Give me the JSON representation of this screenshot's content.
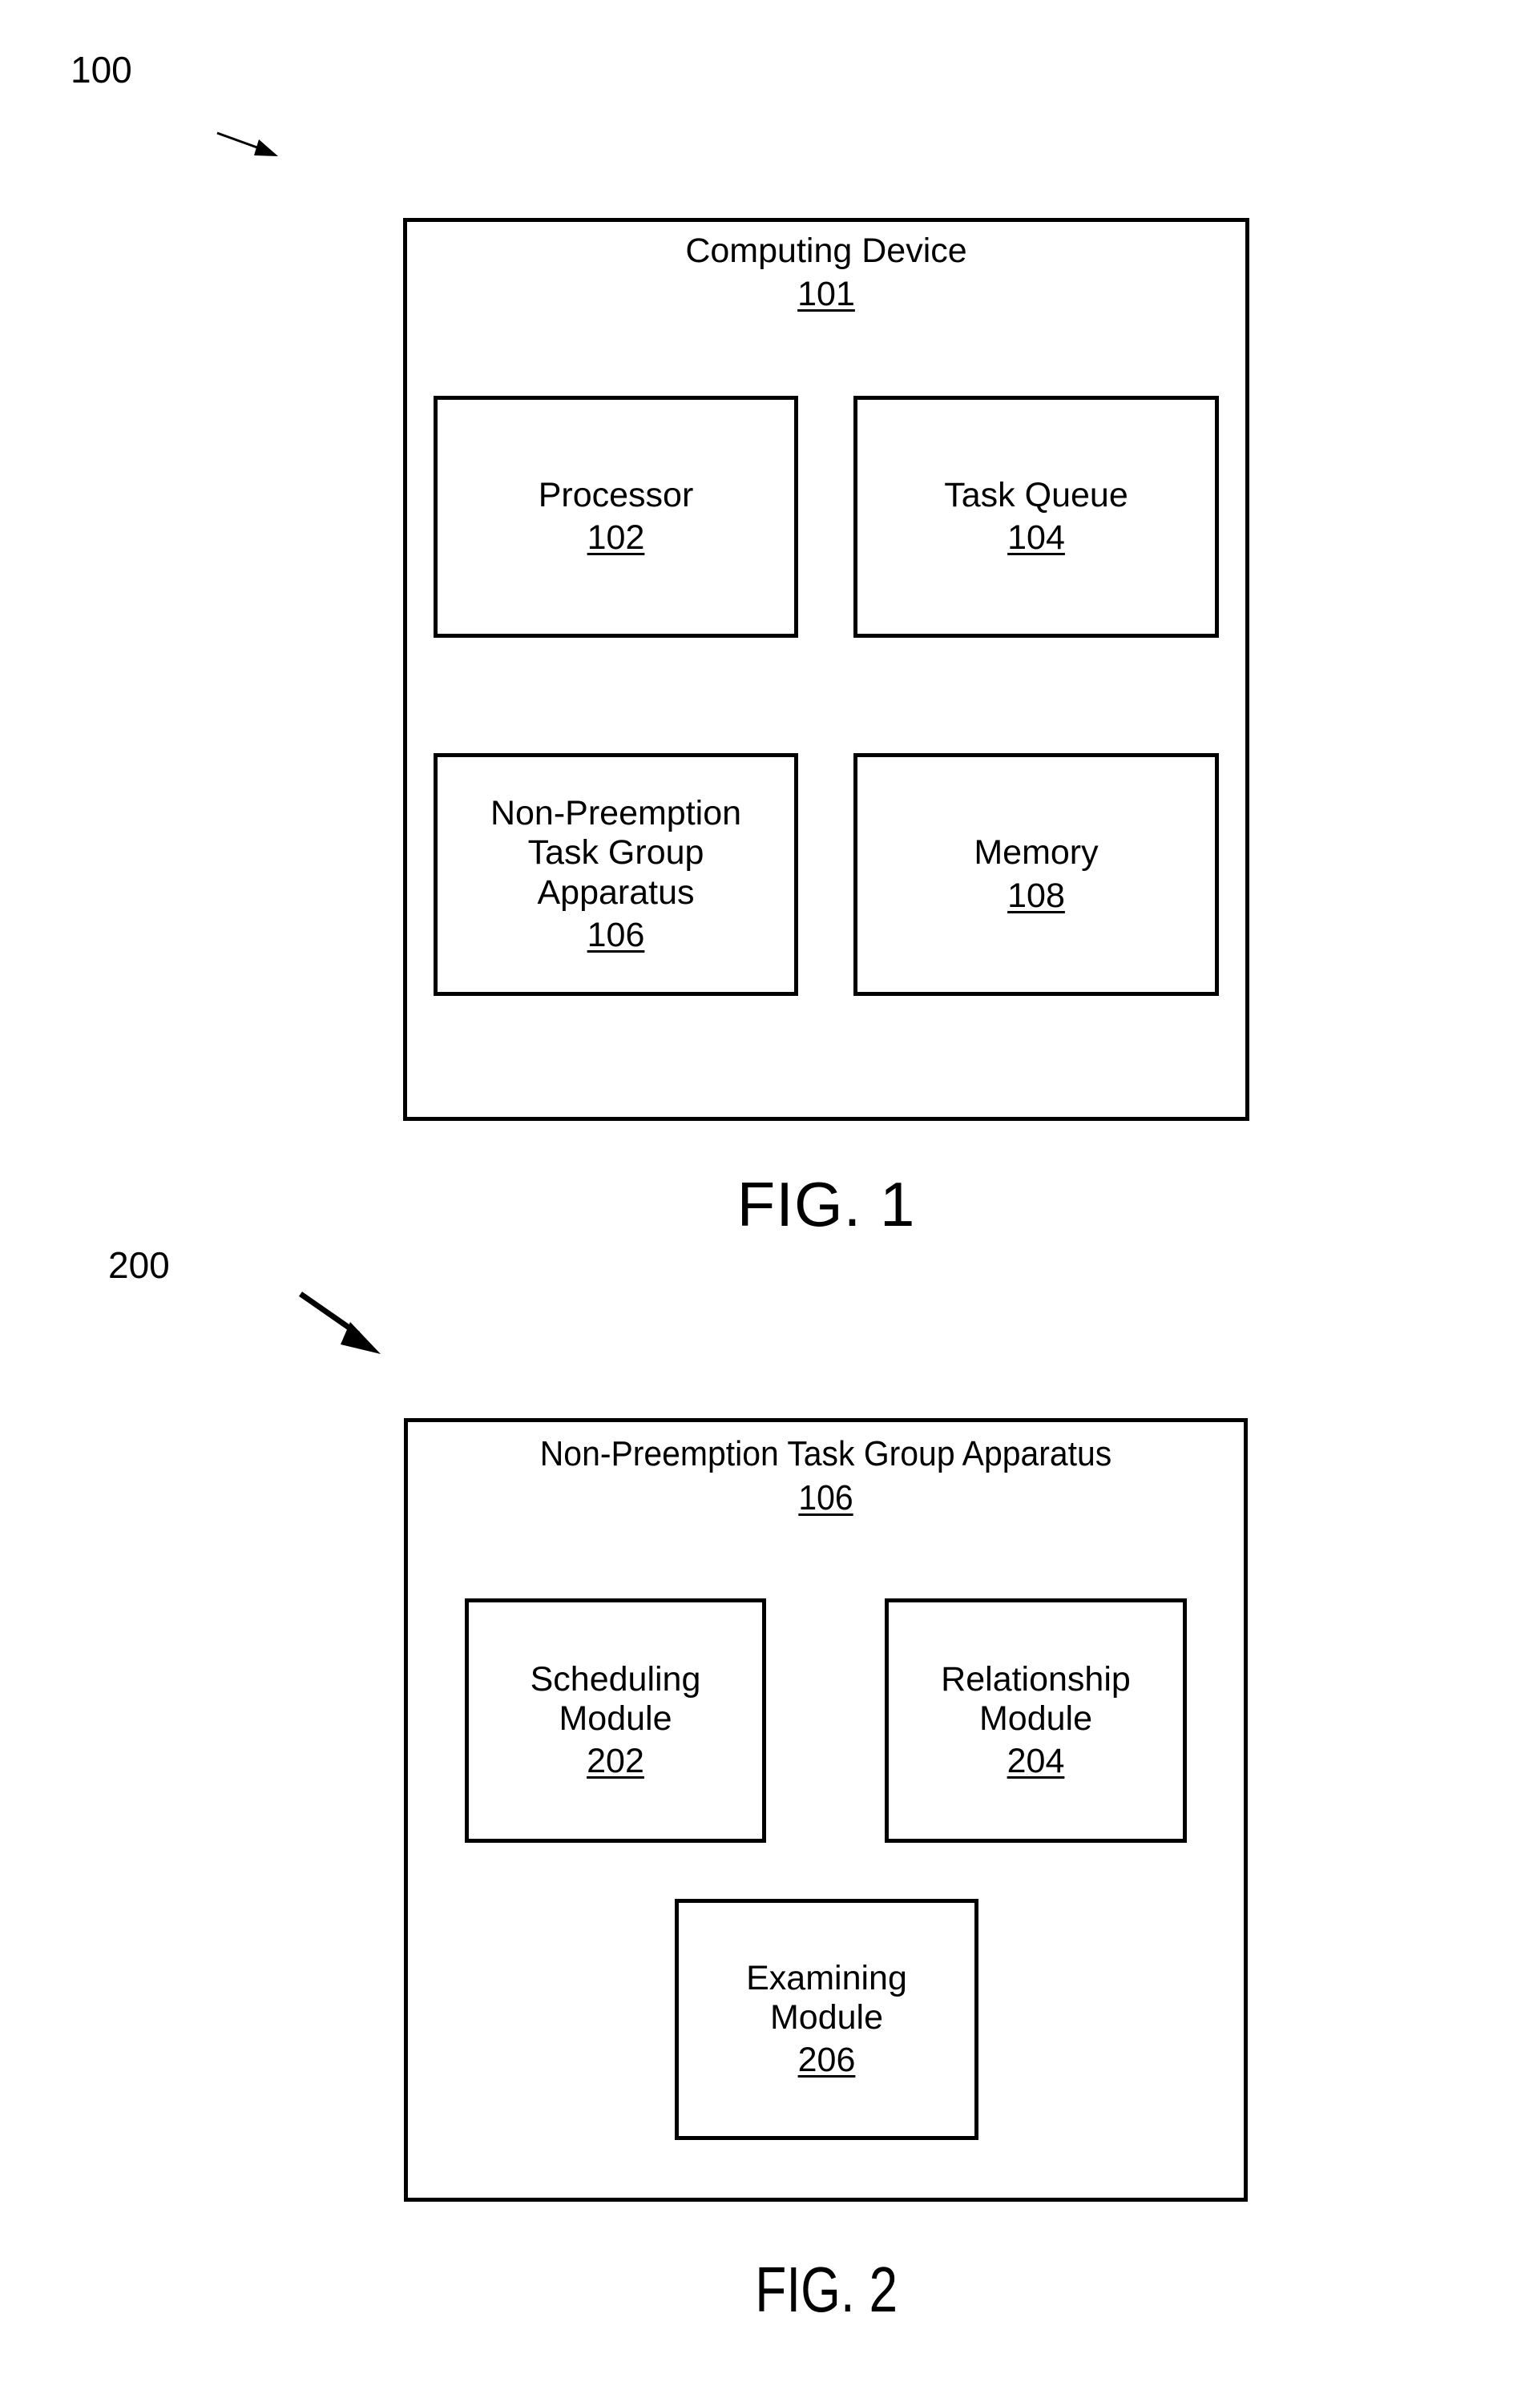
{
  "figures": [
    {
      "callout": "100",
      "caption": "FIG. 1",
      "container": {
        "title": "Computing Device",
        "ref": "101"
      },
      "boxes": [
        {
          "label": "Processor",
          "ref": "102"
        },
        {
          "label": "Task Queue",
          "ref": "104"
        },
        {
          "label": "Non-Preemption\nTask Group\nApparatus",
          "ref": "106"
        },
        {
          "label": "Memory",
          "ref": "108"
        }
      ]
    },
    {
      "callout": "200",
      "caption": "FIG. 2",
      "container": {
        "title": "Non-Preemption Task Group Apparatus",
        "ref": "106"
      },
      "boxes": [
        {
          "label": "Scheduling\nModule",
          "ref": "202"
        },
        {
          "label": "Relationship\nModule",
          "ref": "204"
        },
        {
          "label": "Examining\nModule",
          "ref": "206"
        }
      ]
    }
  ],
  "colors": {
    "ink": "#000000",
    "paper": "#ffffff"
  }
}
